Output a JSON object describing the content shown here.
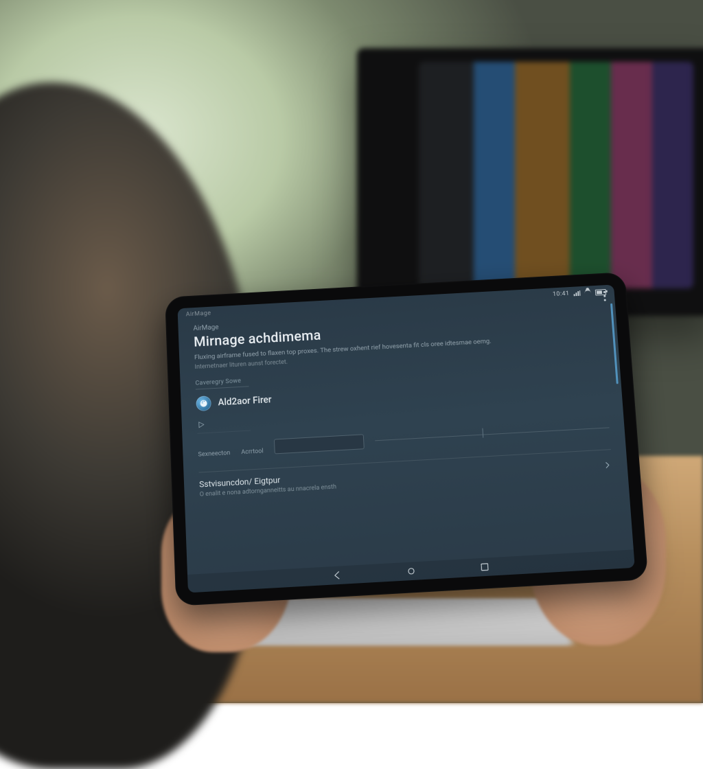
{
  "statusbar": {
    "left_label": "AirMage",
    "time": "10:41",
    "carrier_icons": [
      "signal",
      "wifi",
      "battery"
    ]
  },
  "overflow_label": "More options",
  "app": {
    "breadcrumb": "AirMage",
    "title": "Mirnage achdimema",
    "description_line1": "Fluxing airframe fused to flaxen top proxes. The strew oxhent rief hovesenta fit cls oree idtesmae oemg.",
    "description_line2": "Internetnaer lituren aunst forectet.",
    "category_label": "Caveregry Sowe",
    "adaptor": {
      "icon": "globe",
      "name": "Ald2aor Firer"
    },
    "play_label": "Play",
    "field": {
      "label1": "Sexneecton",
      "label2": "Acrrtool",
      "input_value": ""
    },
    "setting": {
      "title": "Sstvisuncdon/ Eigtpur",
      "subtitle": "O enalit e nona adtornganneitts au nnacrela ensth"
    }
  },
  "nav": {
    "back": "Back",
    "home": "Home",
    "recent": "Recent apps"
  }
}
